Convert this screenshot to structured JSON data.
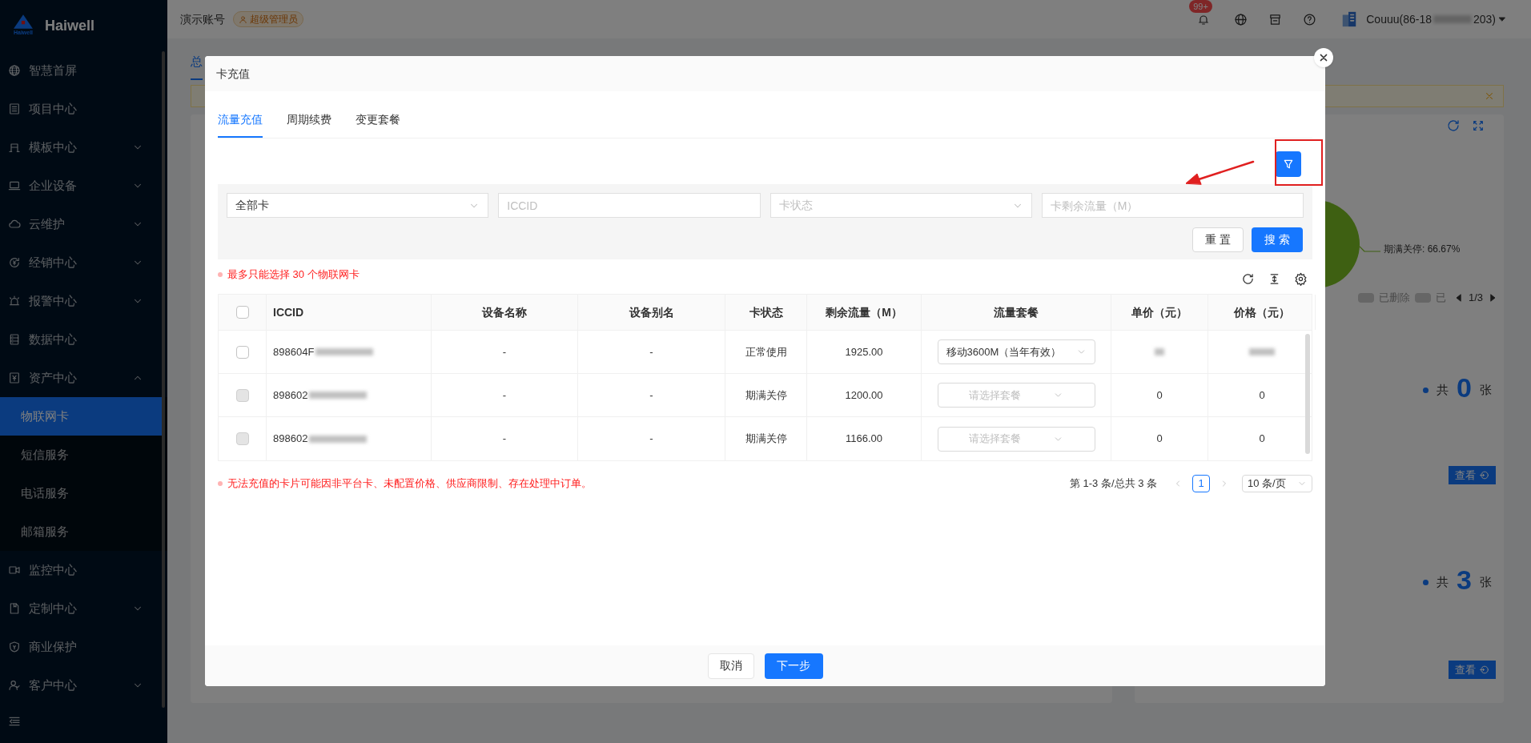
{
  "sidebar": {
    "logo_mark": "Haiwell",
    "logo": "Haiwell",
    "items": [
      {
        "label": "智慧首屏",
        "selected": false
      },
      {
        "label": "项目中心",
        "selected": false
      },
      {
        "label": "模板中心",
        "selected": false,
        "expanded": false
      },
      {
        "label": "企业设备",
        "selected": false,
        "expanded": false
      },
      {
        "label": "云维护",
        "selected": false,
        "expanded": false
      },
      {
        "label": "经销中心",
        "selected": false,
        "expanded": false
      },
      {
        "label": "报警中心",
        "selected": false,
        "expanded": false
      },
      {
        "label": "数据中心",
        "selected": false
      },
      {
        "label": "资产中心",
        "selected": false,
        "expanded": true,
        "children": [
          {
            "label": "物联网卡",
            "selected": true
          },
          {
            "label": "短信服务",
            "selected": false
          },
          {
            "label": "电话服务",
            "selected": false
          },
          {
            "label": "邮箱服务",
            "selected": false
          }
        ]
      },
      {
        "label": "监控中心",
        "selected": false
      },
      {
        "label": "定制中心",
        "selected": false,
        "expanded": false
      },
      {
        "label": "商业保护",
        "selected": false
      },
      {
        "label": "客户中心",
        "selected": false,
        "expanded": false
      }
    ]
  },
  "header": {
    "account": "演示账号",
    "role": "超级管理员",
    "notification_count": "99+",
    "user_prefix": "Couuu(86-18",
    "user_suffix": "203)"
  },
  "page": {
    "tabs": [
      {
        "label": "总",
        "selected": true
      }
    ],
    "right_panel": {
      "pie_label": "期满关停: 66.67%",
      "legend": [
        "已删除",
        "已"
      ],
      "pager": "1/3",
      "stats": [
        {
          "prefix": "共",
          "count": "0",
          "unit": "张",
          "action": "查看"
        },
        {
          "prefix": "共",
          "count": "3",
          "unit": "张",
          "action": "查看"
        }
      ]
    }
  },
  "dialog": {
    "title": "卡充值",
    "tabs": [
      {
        "label": "流量充值",
        "selected": true
      },
      {
        "label": "周期续费",
        "selected": false
      },
      {
        "label": "变更套餐",
        "selected": false
      }
    ],
    "filters": [
      {
        "kind": "select",
        "value": "全部卡"
      },
      {
        "kind": "input",
        "placeholder": "ICCID"
      },
      {
        "kind": "select",
        "placeholder": "卡状态"
      },
      {
        "kind": "input",
        "placeholder": "卡剩余流量（M）"
      }
    ],
    "filter_buttons": [
      {
        "label": "重 置",
        "primary": false
      },
      {
        "label": "搜 索",
        "primary": true
      }
    ],
    "limit_note": "最多只能选择 30 个物联网卡",
    "table": {
      "select_all_checked": false,
      "columns": [
        "ICCID",
        "设备名称",
        "设备别名",
        "卡状态",
        "剩余流量（M）",
        "流量套餐",
        "单价（元）",
        "价格（元）"
      ],
      "rows": [
        {
          "checked": false,
          "disabled": false,
          "iccid": "898604F",
          "device_name": "-",
          "alias": "-",
          "status": "正常使用",
          "remaining": "1925.00",
          "plan": {
            "value": "移动3600M（当年有效）"
          }
        },
        {
          "checked": false,
          "disabled": true,
          "iccid": "898602",
          "device_name": "-",
          "alias": "-",
          "status": "期满关停",
          "remaining": "1200.00",
          "plan": {
            "placeholder": "请选择套餐"
          },
          "unit_price": "0",
          "price": "0"
        },
        {
          "checked": false,
          "disabled": true,
          "iccid": "898602",
          "device_name": "-",
          "alias": "-",
          "status": "期满关停",
          "remaining": "1166.00",
          "plan": {
            "placeholder": "请选择套餐"
          },
          "unit_price": "0",
          "price": "0"
        }
      ]
    },
    "footer_note": "无法充值的卡片可能因非平台卡、未配置价格、供应商限制、存在处理中订单。",
    "pagination": {
      "summary": "第 1-3 条/总共 3 条",
      "pages": [
        {
          "label": "1",
          "selected": true
        }
      ],
      "page_size": "10 条/页"
    },
    "buttons": [
      {
        "label": "取消",
        "primary": false
      },
      {
        "label": "下一步",
        "primary": true
      }
    ]
  }
}
